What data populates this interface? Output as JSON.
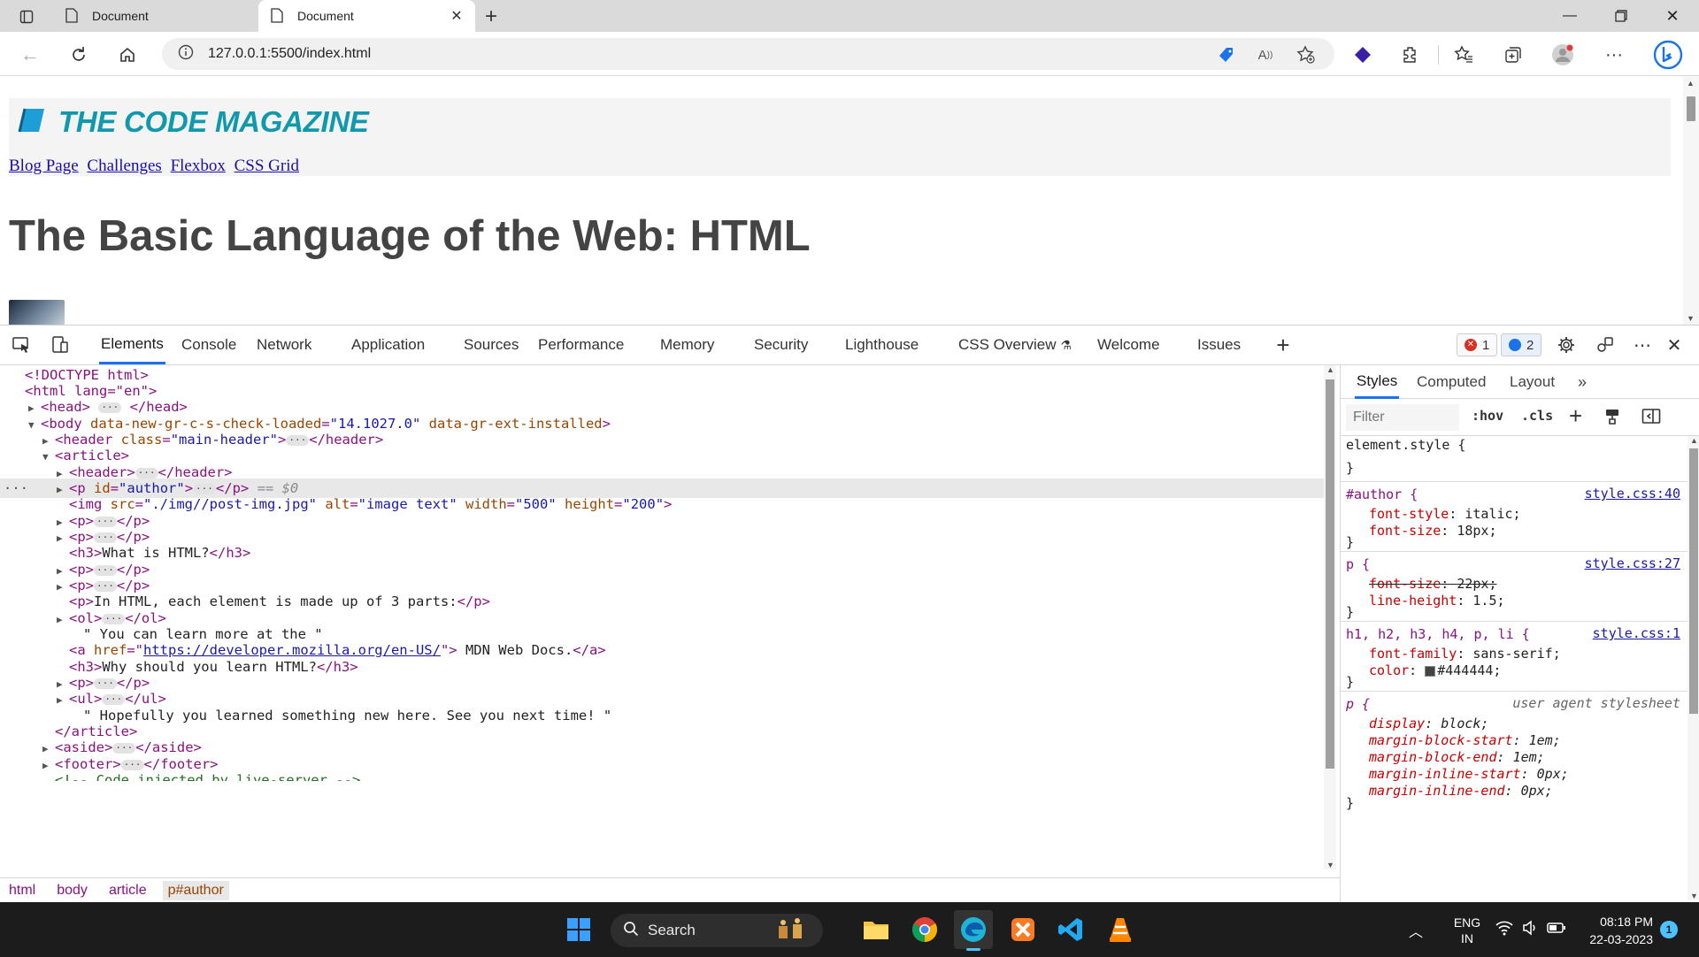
{
  "browser": {
    "tabs": [
      {
        "title": "Document",
        "active": false
      },
      {
        "title": "Document",
        "active": true
      }
    ],
    "url": "127.0.0.1:5500/index.html"
  },
  "page": {
    "site_title": "THE CODE MAGAZINE",
    "nav": [
      "Blog Page",
      "Challenges",
      "Flexbox",
      "CSS Grid"
    ],
    "post_title": "The Basic Language of the Web: HTML"
  },
  "devtools": {
    "tabs": [
      "Elements",
      "Console",
      "Network",
      "Application",
      "Sources",
      "Performance",
      "Memory",
      "Security",
      "Lighthouse",
      "CSS Overview",
      "Welcome",
      "Issues"
    ],
    "error_count": "1",
    "message_count": "2",
    "dom": {
      "doctype": "<!DOCTYPE html>",
      "html_open": "<html lang=\"en\">",
      "head": "<head>",
      "head_close": "</head>",
      "body_tag": "<body",
      "body_attr1_name": "data-new-gr-c-s-check-loaded",
      "body_attr1_value": "\"14.1027.0\"",
      "body_attr2_name": "data-gr-ext-installed",
      "body_close_bracket": ">",
      "header_main_open": "<header",
      "header_class_name": "class",
      "header_class_value": "\"main-header\"",
      "header_close": "</header>",
      "article_open": "<article>",
      "header_open": "<header>",
      "p_author_open": "<p",
      "p_id_name": "id",
      "p_id_value": "\"author\"",
      "p_close": "</p>",
      "dollar0": "== $0",
      "img_open": "<img",
      "img_src_name": "src",
      "img_src_value": "\"./img//post-img.jpg\"",
      "img_alt_name": "alt",
      "img_alt_value": "\"image text\"",
      "img_width_name": "width",
      "img_width_value": "\"500\"",
      "img_height_name": "height",
      "img_height_value": "\"200\"",
      "p_open": "<p>",
      "h3_open": "<h3>",
      "h3_close": "</h3>",
      "h3_what": "What is HTML?",
      "p_parts_text": "In HTML, each element is made up of 3 parts:",
      "ol_open": "<ol>",
      "ol_close": "</ol>",
      "learn_more_text": "\" You can learn more at the \"",
      "a_open": "<a",
      "a_href_name": "href",
      "a_href_value": "https://developer.mozilla.org/en-US/",
      "a_text": " MDN Web Docs.",
      "a_close": "</a>",
      "h3_why": "Why should you learn HTML?",
      "ul_open": "<ul>",
      "ul_close": "</ul>",
      "hopefully_text": "\" Hopefully you learned something new here. See you next time! \"",
      "article_close": "</article>",
      "aside_open": "<aside>",
      "aside_close": "</aside>",
      "footer_open": "<footer>",
      "footer_close": "</footer>",
      "comment": "<!-- Code injected by live-server -->"
    },
    "breadcrumbs": [
      "html",
      "body",
      "article",
      "p#author"
    ],
    "styles": {
      "tabs": [
        "Styles",
        "Computed",
        "Layout"
      ],
      "filter_placeholder": "Filter",
      "hov": ":hov",
      "cls": ".cls",
      "rules": {
        "element_style": "element.style {",
        "close": "}",
        "author_sel": "#author {",
        "author_src": "style.css:40",
        "author_props": [
          {
            "name": "font-style",
            "value": "italic;"
          },
          {
            "name": "font-size",
            "value": "18px;"
          }
        ],
        "p_sel": "p {",
        "p_src": "style.css:27",
        "p_props": [
          {
            "name": "font-size",
            "value": "22px;"
          },
          {
            "name": "line-height",
            "value": "1.5;"
          }
        ],
        "h_sel": "h1, h2, h3, h4, p, li {",
        "h_src": "style.css:1",
        "h_props": [
          {
            "name": "font-family",
            "value": "sans-serif;"
          },
          {
            "name": "color",
            "value": "#444444;"
          }
        ],
        "ua_sel": "p {",
        "ua_src": "user agent stylesheet",
        "ua_props": [
          {
            "name": "display",
            "value": "block;"
          },
          {
            "name": "margin-block-start",
            "value": "1em;"
          },
          {
            "name": "margin-block-end",
            "value": "1em;"
          },
          {
            "name": "margin-inline-start",
            "value": "0px;"
          },
          {
            "name": "margin-inline-end",
            "value": "0px;"
          }
        ]
      }
    }
  },
  "taskbar": {
    "search_label": "Search",
    "lang_line1": "ENG",
    "lang_line2": "IN",
    "time": "08:18 PM",
    "date": "22-03-2023",
    "notification_count": "1"
  },
  "colors": {
    "accent": "#1a73e8",
    "site_title": "#1098ad",
    "heading": "#444444"
  }
}
